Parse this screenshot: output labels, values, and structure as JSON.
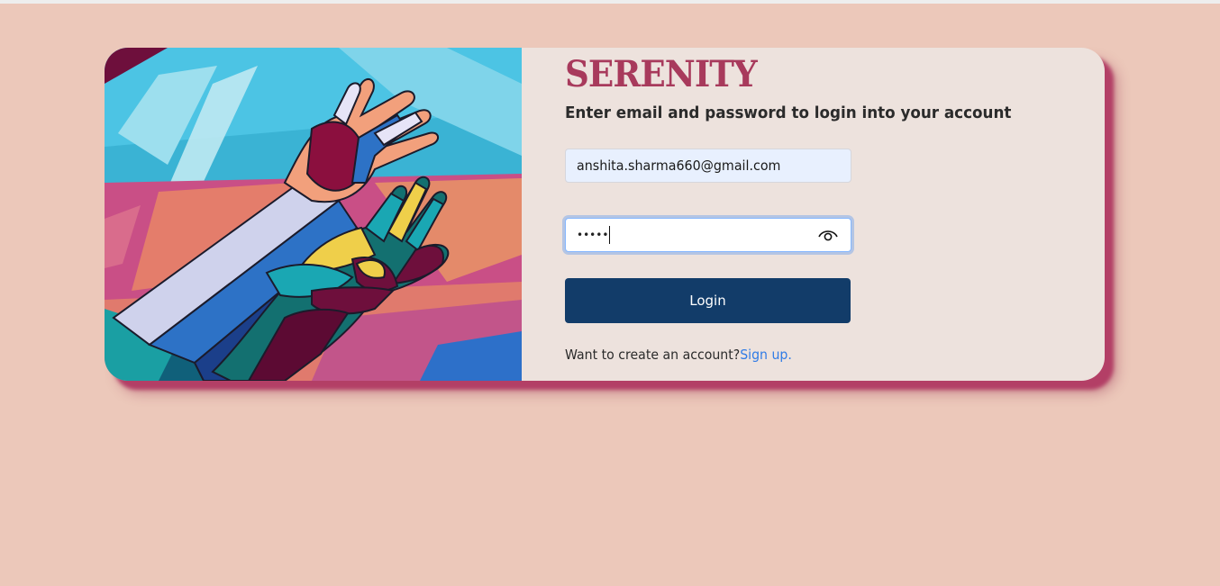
{
  "brand": {
    "name": "SERENITY",
    "color": "#a83a5c"
  },
  "login": {
    "subtitle": "Enter email and password to login into your account",
    "email_value": "anshita.sharma660@gmail.com",
    "password_mask": "•••••",
    "login_label": "Login",
    "signup_prompt": "Want to create an account?",
    "signup_link": "Sign up."
  },
  "icons": {
    "password_toggle": "eye-icon"
  },
  "colors": {
    "background": "#ecc8ba",
    "card": "#ede2dd",
    "button": "#123c69",
    "link": "#2f7be6",
    "shadow": "#b33f66"
  }
}
